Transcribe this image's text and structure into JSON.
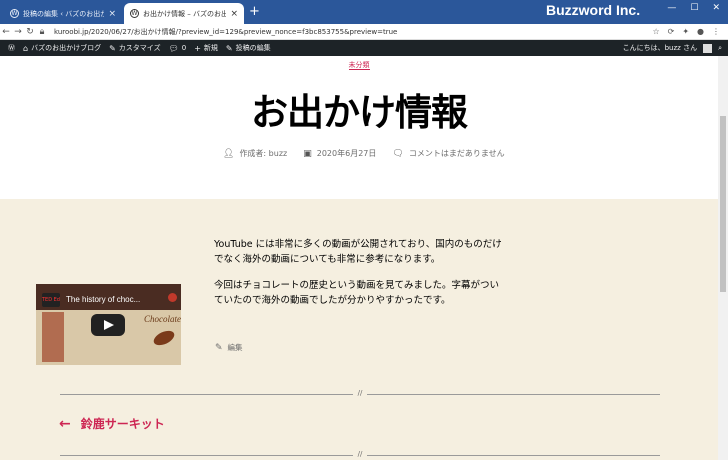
{
  "browser": {
    "tabs": [
      {
        "label": "投稿の編集 ‹ バズのお出かけブログ",
        "active": false
      },
      {
        "label": "お出かけ情報 – バズのお出かけブログ",
        "active": true
      }
    ],
    "brand": "Buzzword Inc.",
    "url": "kuroobi.jp/2020/06/27/お出かけ情報/?preview_id=129&preview_nonce=f3bc853755&preview=true"
  },
  "adminbar": {
    "site_name": "バズのお出かけブログ",
    "customize": "カスタマイズ",
    "comments_count": "0",
    "new": "新規",
    "edit_post": "投稿の編集",
    "greeting": "こんにちは、buzz さん"
  },
  "post": {
    "category": "未分類",
    "title": "お出かけ情報",
    "author": "作成者: buzz",
    "date": "2020年6月27日",
    "comments": "コメントはまだありません",
    "paragraph1": "YouTube には非常に多くの動画が公開されており、国内のものだけでなく海外の動画についても非常に参考になります。",
    "paragraph2": "今回はチョコレートの歴史という動画を見てみました。字幕がついていたので海外の動画でしたが分かりやすかったです。",
    "edit_label": "編集",
    "video": {
      "title": "The history of choc...",
      "logo": "TED Ed",
      "thumb_text": "Chocolate"
    },
    "separator": "//",
    "prev_post": "鈴鹿サーキット"
  },
  "colors": {
    "accent": "#cd2653",
    "content_bg": "#f5efe0",
    "adminbar_bg": "#1d2327",
    "titlebar_bg": "#2b579a"
  }
}
